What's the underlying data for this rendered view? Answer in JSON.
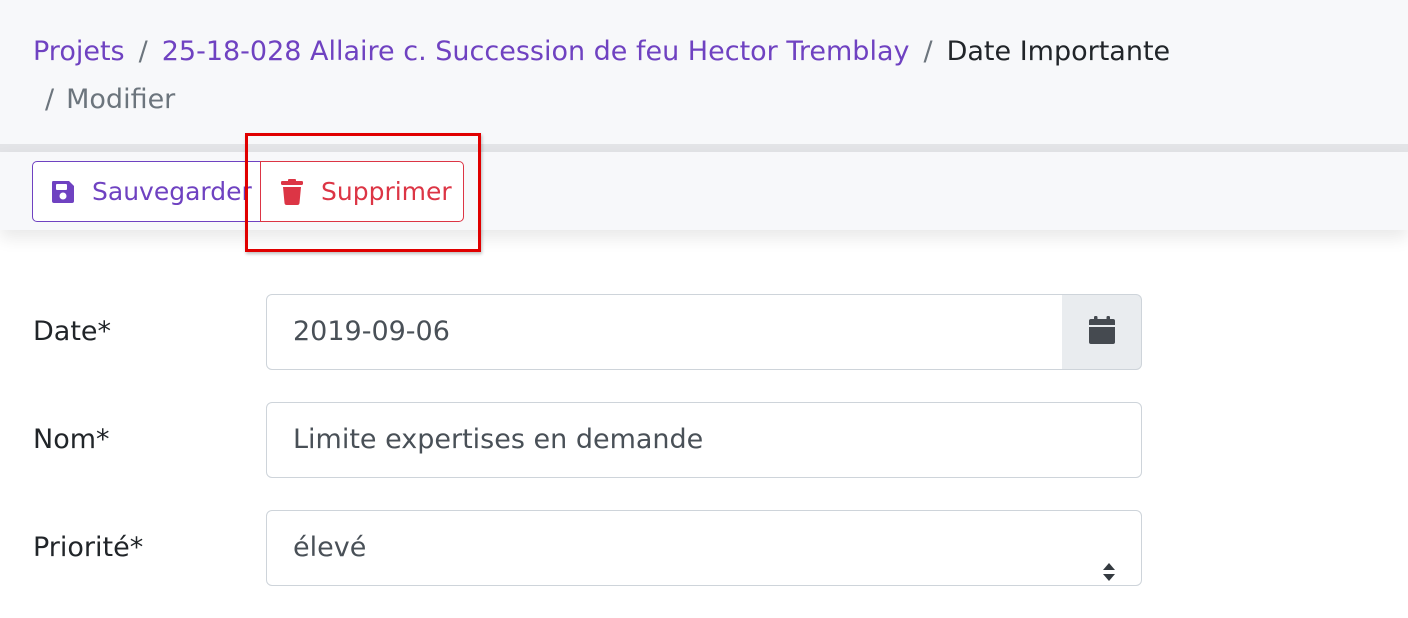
{
  "breadcrumb": {
    "items": [
      {
        "label": "Projets",
        "type": "link"
      },
      {
        "label": "25-18-028 Allaire c. Succession de feu Hector Tremblay",
        "type": "link"
      },
      {
        "label": "Date Importante",
        "type": "current"
      },
      {
        "label": "Modifier",
        "type": "muted"
      }
    ],
    "separator": "/"
  },
  "toolbar": {
    "save_label": "Sauvegarder",
    "save_icon": "floppy-disk-icon",
    "delete_label": "Supprimer",
    "delete_icon": "trash-icon"
  },
  "form": {
    "date": {
      "label": "Date*",
      "value": "2019-09-06",
      "addon_icon": "calendar-icon"
    },
    "name": {
      "label": "Nom*",
      "value": "Limite expertises en demande"
    },
    "priority": {
      "label": "Priorité*",
      "selected": "élevé"
    }
  },
  "colors": {
    "primary": "#6f42c1",
    "danger": "#dc3545",
    "highlight": "#e00000",
    "text": "#212529",
    "muted": "#6c757d",
    "border": "#ced4da"
  }
}
